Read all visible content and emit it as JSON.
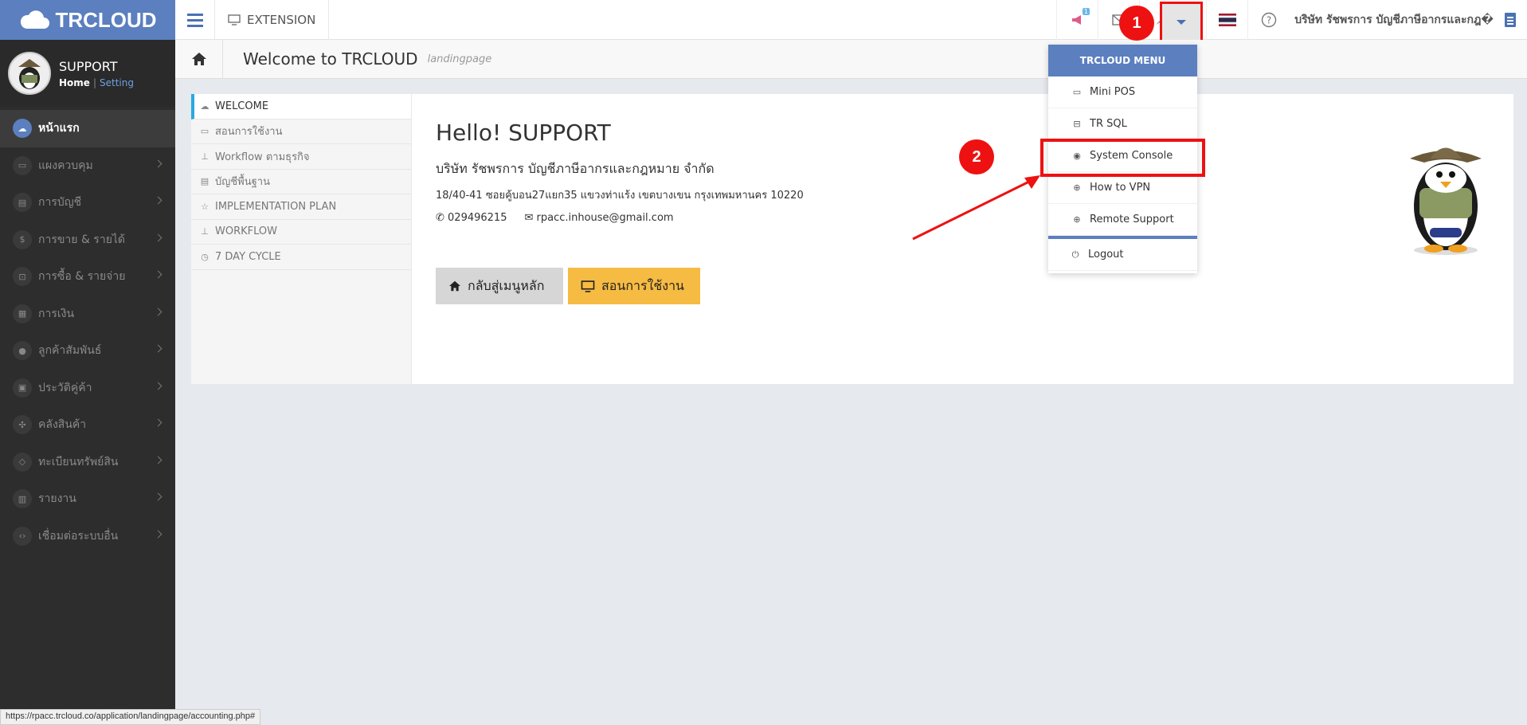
{
  "app": {
    "logo_text": "TRCLOUD"
  },
  "topbar": {
    "extension_label": "EXTENSION",
    "announce_badge": "1",
    "company_name": "บริษัท รัชพรการ บัญชีภาษีอากรและกฎ�"
  },
  "sidebar": {
    "profile": {
      "name": "SUPPORT",
      "home_link": "Home",
      "setting_link": "Setting"
    },
    "items": [
      {
        "label": "หน้าแรก",
        "icon": "cloud-icon"
      },
      {
        "label": "แผงควบคุม",
        "icon": "monitor-icon"
      },
      {
        "label": "การบัญชี",
        "icon": "book-icon"
      },
      {
        "label": "การขาย & รายได้",
        "icon": "dollar-icon"
      },
      {
        "label": "การซื้อ & รายจ่าย",
        "icon": "cart-icon"
      },
      {
        "label": "การเงิน",
        "icon": "calendar-icon"
      },
      {
        "label": "ลูกค้าสัมพันธ์",
        "icon": "users-icon"
      },
      {
        "label": "ประวัติคู่ค้า",
        "icon": "contact-icon"
      },
      {
        "label": "คลังสินค้า",
        "icon": "cubes-icon"
      },
      {
        "label": "ทะเบียนทรัพย์สิน",
        "icon": "diamond-icon"
      },
      {
        "label": "รายงาน",
        "icon": "report-icon"
      },
      {
        "label": "เชื่อมต่อระบบอื่น",
        "icon": "code-icon"
      }
    ]
  },
  "header": {
    "title": "Welcome to TRCLOUD",
    "subtitle": "landingpage"
  },
  "leftmenu": [
    {
      "label": "WELCOME",
      "icon": "cloud-icon"
    },
    {
      "label": "สอนการใช้งาน",
      "icon": "monitor-icon"
    },
    {
      "label": "Workflow ตามธุรกิจ",
      "icon": "sitemap-icon"
    },
    {
      "label": "บัญชีพื้นฐาน",
      "icon": "book-icon"
    },
    {
      "label": "IMPLEMENTATION PLAN",
      "icon": "star-icon"
    },
    {
      "label": "WORKFLOW",
      "icon": "sitemap-icon"
    },
    {
      "label": "7 DAY CYCLE",
      "icon": "clock-icon"
    }
  ],
  "main": {
    "hello": "Hello! SUPPORT",
    "company": "บริษัท รัชพรการ บัญชีภาษีอากรและกฎหมาย จำกัด",
    "address": "18/40-41 ซอยคู้บอน27แยก35 แขวงท่าแร้ง เขตบางเขน กรุงเทพมหานคร 10220",
    "phone": "029496215",
    "email": "rpacc.inhouse@gmail.com",
    "btn_back": "กลับสู่เมนูหลัก",
    "btn_train": "สอนการใช้งาน"
  },
  "dropdown": {
    "header": "TRCLOUD MENU",
    "items": [
      "Mini POS",
      "TR SQL",
      "System Console",
      "How to VPN",
      "Remote Support"
    ],
    "logout": "Logout"
  },
  "annotations": {
    "marker1": "1",
    "marker2": "2"
  },
  "statusbar": {
    "url": "https://rpacc.trcloud.co/application/landingpage/accounting.php#"
  },
  "colors": {
    "brand": "#5b7fbf",
    "highlight": "#e11111",
    "train_button": "#f6bb42"
  }
}
